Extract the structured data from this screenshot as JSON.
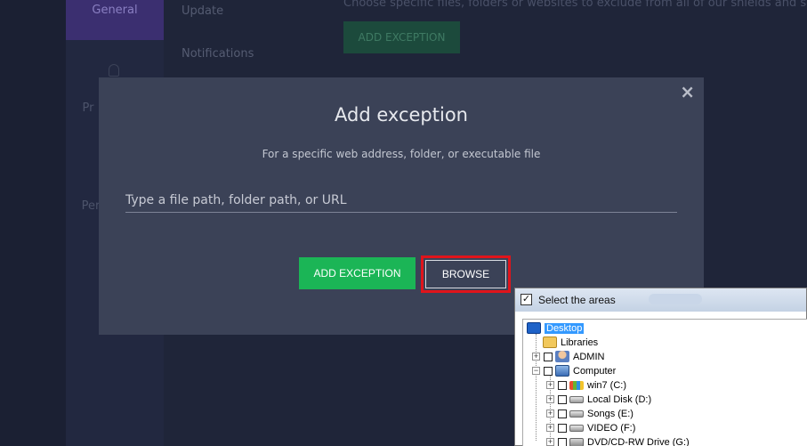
{
  "background": {
    "subnav": {
      "active_item": "General",
      "item_pr": "Pr",
      "item_per": "Per"
    },
    "sections": {
      "update": "Update",
      "notifications": "Notifications"
    },
    "description": "Choose specific files, folders or websites to exclude from all of our shields and scans.",
    "add_exception_label": "ADD EXCEPTION"
  },
  "modal": {
    "close_label": "×",
    "title": "Add exception",
    "subtitle": "For a specific web address, folder, or executable file",
    "input_value": "",
    "input_placeholder": "Type a file path, folder path, or URL",
    "add_button_label": "ADD EXCEPTION",
    "browse_button_label": "BROWSE"
  },
  "select_window": {
    "checkbox_glyph": "✓",
    "title": "Select the areas",
    "tree": [
      {
        "label": "Desktop",
        "icon": "desktop-icon",
        "selected": true
      },
      {
        "label": "Libraries",
        "icon": "libraries-icon"
      },
      {
        "label": "ADMIN",
        "icon": "user-folder-icon"
      },
      {
        "label": "Computer",
        "icon": "computer-icon"
      },
      {
        "label": "win7 (C:)",
        "icon": "windows-drive-icon"
      },
      {
        "label": "Local Disk (D:)",
        "icon": "hard-drive-icon"
      },
      {
        "label": "Songs (E:)",
        "icon": "hard-drive-icon"
      },
      {
        "label": "VIDEO (F:)",
        "icon": "hard-drive-icon"
      },
      {
        "label": "DVD/CD-RW Drive (G:)",
        "icon": "dvd-drive-icon"
      }
    ]
  },
  "colors": {
    "accent_green": "#1bb556",
    "highlight_red": "#e0141b",
    "modal_bg": "#3b4257",
    "active_purple": "#3b2f70"
  }
}
